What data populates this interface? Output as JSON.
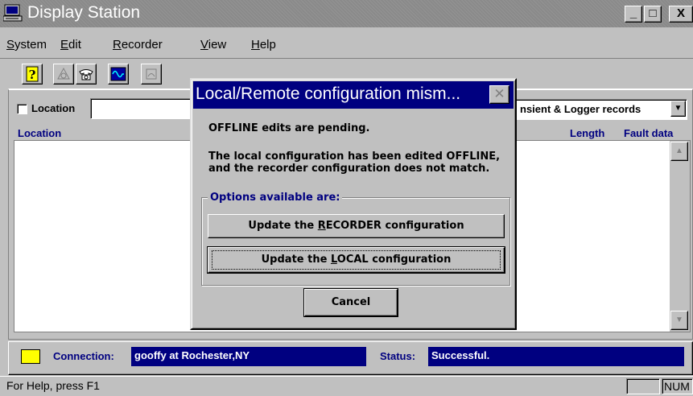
{
  "window": {
    "title": "Display Station",
    "minimize": "_",
    "maximize": "□",
    "close": "X"
  },
  "menu": [
    {
      "label": "System",
      "underline": "S",
      "rest": "ystem"
    },
    {
      "label": "Edit",
      "underline": "E",
      "rest": "dit"
    },
    {
      "label": "Recorder",
      "underline": "R",
      "rest": "ecorder"
    },
    {
      "label": "View",
      "underline": "V",
      "rest": "iew"
    },
    {
      "label": "Help",
      "underline": "H",
      "rest": "elp"
    }
  ],
  "toolbar": {
    "icons": [
      "help-question-icon",
      "dial-icon",
      "telephone-icon",
      "waveform-icon",
      "hangup-icon"
    ]
  },
  "filter": {
    "location_label": "Location",
    "location_value": "",
    "records_select": "nsient & Logger records"
  },
  "list": {
    "columns": [
      "Location",
      "Length",
      "Fault data"
    ]
  },
  "connection": {
    "label": "Connection:",
    "value": "gooffy at Rochester,NY",
    "status_label": "Status:",
    "status_value": "Successful.",
    "led_color": "#ffff00"
  },
  "statusbar": {
    "help": "For Help, press F1",
    "indicator": "NUM"
  },
  "dialog": {
    "title": "Local/Remote configuration mism...",
    "message1": "OFFLINE edits are pending.",
    "message2": "The local configuration has been edited OFFLINE, and the recorder configuration does not match.",
    "options_label": "Options available are:",
    "btn_recorder_pre": "Update the ",
    "btn_recorder_u": "R",
    "btn_recorder_post": "ECORDER configuration",
    "btn_local_pre": "Update the ",
    "btn_local_u": "L",
    "btn_local_post": "OCAL configuration",
    "btn_cancel": "Cancel"
  },
  "colors": {
    "titlebar_inactive": "#8a8a8a",
    "dialog_title": "#000080",
    "face": "#c0c0c0",
    "label_blue": "#000080"
  }
}
